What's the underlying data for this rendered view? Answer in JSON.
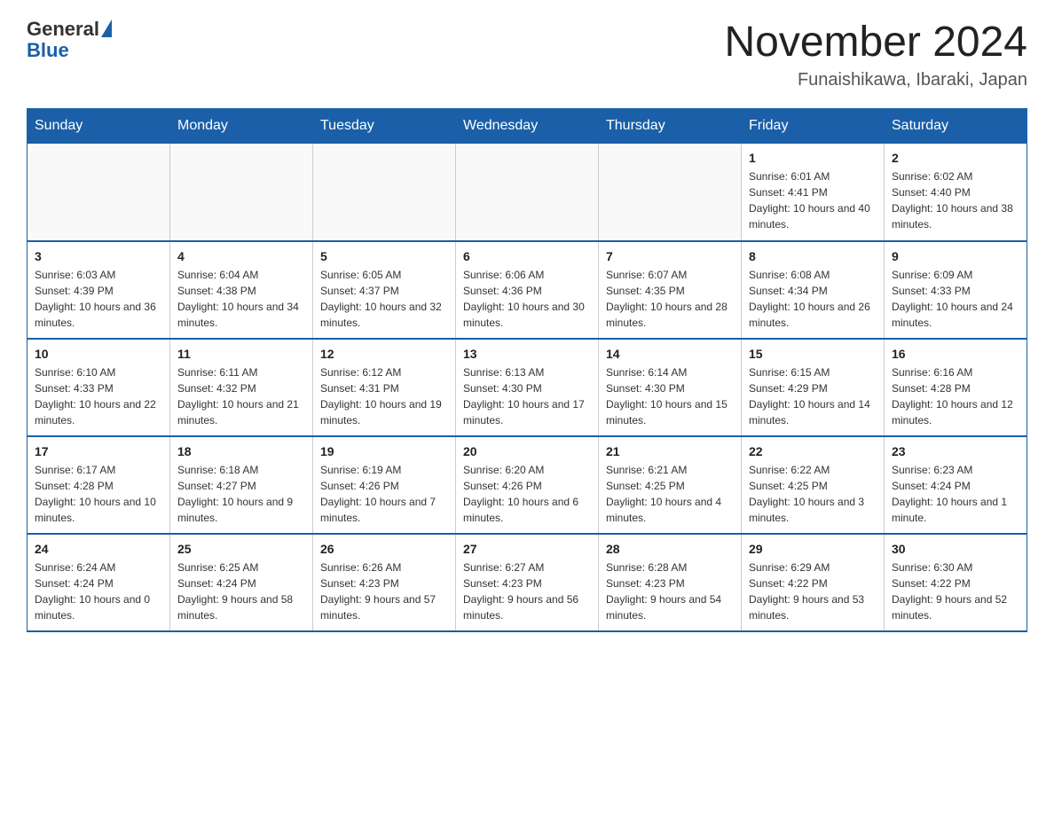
{
  "header": {
    "logo_general": "General",
    "logo_blue": "Blue",
    "title": "November 2024",
    "subtitle": "Funaishikawa, Ibaraki, Japan"
  },
  "weekdays": [
    "Sunday",
    "Monday",
    "Tuesday",
    "Wednesday",
    "Thursday",
    "Friday",
    "Saturday"
  ],
  "weeks": [
    [
      {
        "day": "",
        "info": ""
      },
      {
        "day": "",
        "info": ""
      },
      {
        "day": "",
        "info": ""
      },
      {
        "day": "",
        "info": ""
      },
      {
        "day": "",
        "info": ""
      },
      {
        "day": "1",
        "info": "Sunrise: 6:01 AM\nSunset: 4:41 PM\nDaylight: 10 hours and 40 minutes."
      },
      {
        "day": "2",
        "info": "Sunrise: 6:02 AM\nSunset: 4:40 PM\nDaylight: 10 hours and 38 minutes."
      }
    ],
    [
      {
        "day": "3",
        "info": "Sunrise: 6:03 AM\nSunset: 4:39 PM\nDaylight: 10 hours and 36 minutes."
      },
      {
        "day": "4",
        "info": "Sunrise: 6:04 AM\nSunset: 4:38 PM\nDaylight: 10 hours and 34 minutes."
      },
      {
        "day": "5",
        "info": "Sunrise: 6:05 AM\nSunset: 4:37 PM\nDaylight: 10 hours and 32 minutes."
      },
      {
        "day": "6",
        "info": "Sunrise: 6:06 AM\nSunset: 4:36 PM\nDaylight: 10 hours and 30 minutes."
      },
      {
        "day": "7",
        "info": "Sunrise: 6:07 AM\nSunset: 4:35 PM\nDaylight: 10 hours and 28 minutes."
      },
      {
        "day": "8",
        "info": "Sunrise: 6:08 AM\nSunset: 4:34 PM\nDaylight: 10 hours and 26 minutes."
      },
      {
        "day": "9",
        "info": "Sunrise: 6:09 AM\nSunset: 4:33 PM\nDaylight: 10 hours and 24 minutes."
      }
    ],
    [
      {
        "day": "10",
        "info": "Sunrise: 6:10 AM\nSunset: 4:33 PM\nDaylight: 10 hours and 22 minutes."
      },
      {
        "day": "11",
        "info": "Sunrise: 6:11 AM\nSunset: 4:32 PM\nDaylight: 10 hours and 21 minutes."
      },
      {
        "day": "12",
        "info": "Sunrise: 6:12 AM\nSunset: 4:31 PM\nDaylight: 10 hours and 19 minutes."
      },
      {
        "day": "13",
        "info": "Sunrise: 6:13 AM\nSunset: 4:30 PM\nDaylight: 10 hours and 17 minutes."
      },
      {
        "day": "14",
        "info": "Sunrise: 6:14 AM\nSunset: 4:30 PM\nDaylight: 10 hours and 15 minutes."
      },
      {
        "day": "15",
        "info": "Sunrise: 6:15 AM\nSunset: 4:29 PM\nDaylight: 10 hours and 14 minutes."
      },
      {
        "day": "16",
        "info": "Sunrise: 6:16 AM\nSunset: 4:28 PM\nDaylight: 10 hours and 12 minutes."
      }
    ],
    [
      {
        "day": "17",
        "info": "Sunrise: 6:17 AM\nSunset: 4:28 PM\nDaylight: 10 hours and 10 minutes."
      },
      {
        "day": "18",
        "info": "Sunrise: 6:18 AM\nSunset: 4:27 PM\nDaylight: 10 hours and 9 minutes."
      },
      {
        "day": "19",
        "info": "Sunrise: 6:19 AM\nSunset: 4:26 PM\nDaylight: 10 hours and 7 minutes."
      },
      {
        "day": "20",
        "info": "Sunrise: 6:20 AM\nSunset: 4:26 PM\nDaylight: 10 hours and 6 minutes."
      },
      {
        "day": "21",
        "info": "Sunrise: 6:21 AM\nSunset: 4:25 PM\nDaylight: 10 hours and 4 minutes."
      },
      {
        "day": "22",
        "info": "Sunrise: 6:22 AM\nSunset: 4:25 PM\nDaylight: 10 hours and 3 minutes."
      },
      {
        "day": "23",
        "info": "Sunrise: 6:23 AM\nSunset: 4:24 PM\nDaylight: 10 hours and 1 minute."
      }
    ],
    [
      {
        "day": "24",
        "info": "Sunrise: 6:24 AM\nSunset: 4:24 PM\nDaylight: 10 hours and 0 minutes."
      },
      {
        "day": "25",
        "info": "Sunrise: 6:25 AM\nSunset: 4:24 PM\nDaylight: 9 hours and 58 minutes."
      },
      {
        "day": "26",
        "info": "Sunrise: 6:26 AM\nSunset: 4:23 PM\nDaylight: 9 hours and 57 minutes."
      },
      {
        "day": "27",
        "info": "Sunrise: 6:27 AM\nSunset: 4:23 PM\nDaylight: 9 hours and 56 minutes."
      },
      {
        "day": "28",
        "info": "Sunrise: 6:28 AM\nSunset: 4:23 PM\nDaylight: 9 hours and 54 minutes."
      },
      {
        "day": "29",
        "info": "Sunrise: 6:29 AM\nSunset: 4:22 PM\nDaylight: 9 hours and 53 minutes."
      },
      {
        "day": "30",
        "info": "Sunrise: 6:30 AM\nSunset: 4:22 PM\nDaylight: 9 hours and 52 minutes."
      }
    ]
  ]
}
